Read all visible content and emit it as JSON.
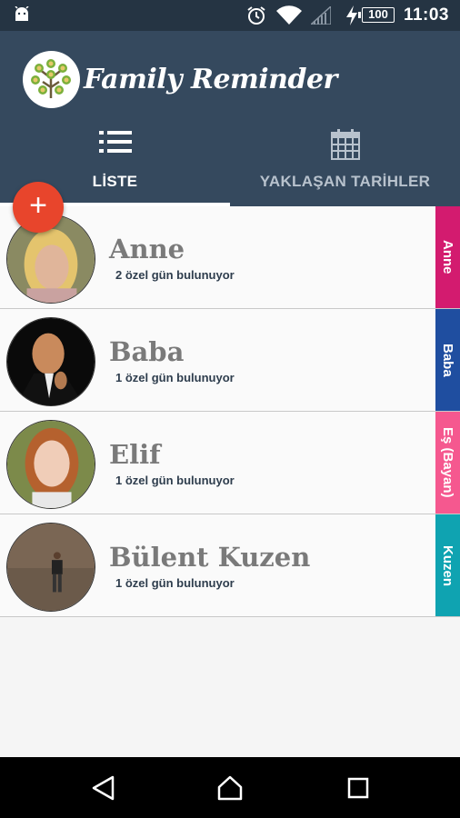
{
  "status_bar": {
    "time": "11:03",
    "battery": "100",
    "icons": [
      "android-icon",
      "alarm-icon",
      "wifi-icon",
      "signal-icon",
      "charging-icon",
      "battery-icon"
    ]
  },
  "app": {
    "title": "Family Reminder"
  },
  "tabs": [
    {
      "label": "LİSTE",
      "icon": "list-icon",
      "active": true
    },
    {
      "label": "YAKLAŞAN TARİHLER",
      "icon": "calendar-icon",
      "active": false
    }
  ],
  "fab": {
    "label": "+"
  },
  "contacts": [
    {
      "name": "Anne",
      "count_text": "2 özel gün bulunuyor",
      "tag": "Anne",
      "tag_color": "#d31b6f"
    },
    {
      "name": "Baba",
      "count_text": "1 özel gün bulunuyor",
      "tag": "Baba",
      "tag_color": "#1f4ea0"
    },
    {
      "name": "Elif",
      "count_text": "1 özel gün bulunuyor",
      "tag": "Eş (Bayan)",
      "tag_color": "#f5588f"
    },
    {
      "name": "Bülent Kuzen",
      "count_text": "1 özel gün bulunuyor",
      "tag": "Kuzen",
      "tag_color": "#0fa3b1"
    }
  ],
  "colors": {
    "status_bar": "#253443",
    "app_bar": "#35495e",
    "fab": "#e8452c"
  }
}
